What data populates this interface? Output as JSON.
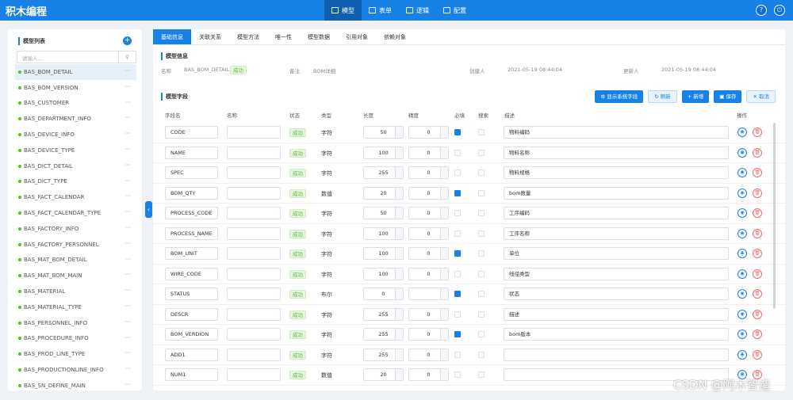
{
  "app_title": "积木编程",
  "nav": [
    {
      "label": "模型",
      "icon": "model-icon"
    },
    {
      "label": "表单",
      "icon": "form-icon"
    },
    {
      "label": "逻辑",
      "icon": "logic-icon"
    },
    {
      "label": "配置",
      "icon": "config-icon"
    }
  ],
  "sidebar": {
    "title": "模型列表",
    "search_placeholder": "请输入...",
    "items": [
      "BAS_BOM_DETAIL",
      "BAS_BOM_VERSION",
      "BAS_CUSTOMER",
      "BAS_DEPARTMENT_INFO",
      "BAS_DEVICE_INFO",
      "BAS_DEVICE_TYPE",
      "BAS_DICT_DETAIL",
      "BAS_DICT_TYPE",
      "BAS_FACT_CALENDAR",
      "BAS_FACT_CALENDAR_TYPE",
      "BAS_FACTORY_INFO",
      "BAS_FACTORY_PERSONNEL",
      "BAS_MAT_BOM_DETAIL",
      "BAS_MAT_BOM_MAIN",
      "BAS_MATERIAL",
      "BAS_MATERIAL_TYPE",
      "BAS_PERSONNEL_INFO",
      "BAS_PROCEDURE_INFO",
      "BAS_PROD_LINE_TYPE",
      "BAS_PRODUCTIONLINE_INFO",
      "BAS_SN_DEFINE_MAIN"
    ]
  },
  "tabs": [
    "基础信息",
    "关联关系",
    "模型方法",
    "唯一性",
    "模型数据",
    "引用对象",
    "依赖对象"
  ],
  "model_info": {
    "title": "模型信息",
    "name_label": "名称",
    "name": "BAS_BOM_DETAIL",
    "status": "成功",
    "remark_label": "备注",
    "remark": "BOM详细",
    "creator_label": "创建人",
    "created": "2021-05-19 08:44:04",
    "updater_label": "更新人",
    "updated": "2021-05-19 08:44:04"
  },
  "fields_title": "模型字段",
  "buttons": {
    "show_sys": "显示系统字段",
    "refresh": "刷新",
    "add": "新增",
    "save": "保存",
    "cancel": "取消"
  },
  "headers": [
    "字段名",
    "名称",
    "状态",
    "类型",
    "长度",
    "精度",
    "必填",
    "搜索",
    "描述",
    "操作"
  ],
  "rows": [
    [
      "CODE",
      "成功",
      "字符",
      "50",
      "0",
      true,
      "物料编码"
    ],
    [
      "NAME",
      "成功",
      "字符",
      "100",
      "0",
      false,
      "物料名称"
    ],
    [
      "SPEC",
      "成功",
      "字符",
      "255",
      "0",
      false,
      "物料规格"
    ],
    [
      "BOM_QTY",
      "成功",
      "数值",
      "20",
      "0",
      true,
      "bom数量"
    ],
    [
      "PROCESS_CODE",
      "成功",
      "字符",
      "50",
      "0",
      false,
      "工序编码"
    ],
    [
      "PROCESS_NAME",
      "成功",
      "字符",
      "100",
      "0",
      false,
      "工序名称"
    ],
    [
      "BOM_UNIT",
      "成功",
      "字符",
      "100",
      "0",
      true,
      "单位"
    ],
    [
      "WIRE_CODE",
      "成功",
      "字符",
      "100",
      "0",
      false,
      "线径类型"
    ],
    [
      "STATUS",
      "成功",
      "布尔",
      "0",
      "",
      true,
      "状态"
    ],
    [
      "DESCR",
      "成功",
      "字符",
      "255",
      "0",
      false,
      "描述"
    ],
    [
      "BOM_VERDION",
      "成功",
      "字符",
      "255",
      "0",
      true,
      "bom版本"
    ],
    [
      "ADD1",
      "成功",
      "字符",
      "255",
      "0",
      false,
      ""
    ],
    [
      "NUM1",
      "成功",
      "数值",
      "20",
      "0",
      false,
      ""
    ]
  ],
  "watermark": "CSDN @阿木智造"
}
